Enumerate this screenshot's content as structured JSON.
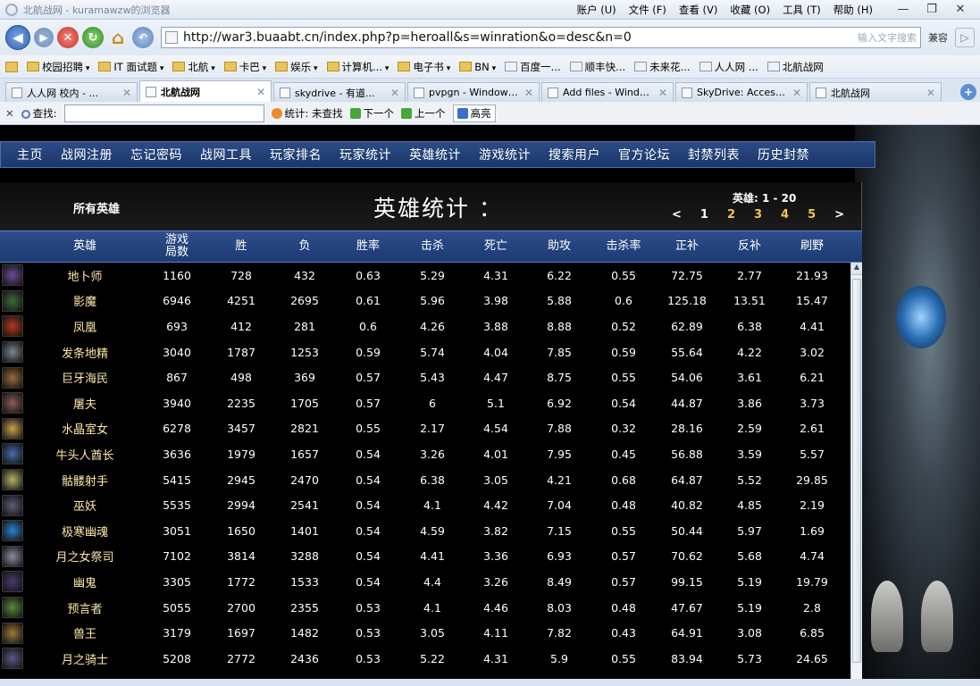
{
  "window": {
    "title": "北航战网 - kuramawzw的浏览器",
    "menus": [
      "账户 (U)",
      "文件 (F)",
      "查看 (V)",
      "收藏 (O)",
      "工具 (T)",
      "帮助 (H)"
    ],
    "controls": [
      "—",
      "❐",
      "✕"
    ]
  },
  "address": {
    "url": "http://war3.buaabt.cn/index.php?p=heroall&s=winration&o=desc&n=0",
    "search_hint": "输入文字搜索",
    "compat_label": "兼容"
  },
  "favorites": [
    {
      "label": "校园招聘",
      "type": "folder"
    },
    {
      "label": "IT 面试题",
      "type": "folder"
    },
    {
      "label": "北航",
      "type": "folder"
    },
    {
      "label": "卡巴",
      "type": "folder"
    },
    {
      "label": "娱乐",
      "type": "folder"
    },
    {
      "label": "计算机...",
      "type": "folder"
    },
    {
      "label": "电子书",
      "type": "folder"
    },
    {
      "label": "BN",
      "type": "folder"
    },
    {
      "label": "百度一...",
      "type": "link"
    },
    {
      "label": "顺丰快...",
      "type": "link"
    },
    {
      "label": "未来花...",
      "type": "link"
    },
    {
      "label": "人人网 ...",
      "type": "link"
    },
    {
      "label": "北航战网",
      "type": "link"
    }
  ],
  "tabs": [
    {
      "label": "人人网 校内 - ...",
      "active": false
    },
    {
      "label": "北航战网",
      "active": true
    },
    {
      "label": "skydrive - 有道...",
      "active": false
    },
    {
      "label": "pvpgn - Windows...",
      "active": false
    },
    {
      "label": "Add files - Windo...",
      "active": false
    },
    {
      "label": "SkyDrive: Access...",
      "active": false
    },
    {
      "label": "北航战网",
      "active": false
    }
  ],
  "findbar": {
    "close": "✕",
    "find_label": "查找:",
    "find_value": "",
    "stats_label": "统计: 未查找",
    "next_label": "下一个",
    "prev_label": "上一个",
    "highlight_label": "高亮"
  },
  "site_nav": [
    "主页",
    "战网注册",
    "忘记密码",
    "战网工具",
    "玩家排名",
    "玩家统计",
    "英雄统计",
    "游戏统计",
    "搜索用户",
    "官方论坛",
    "封禁列表",
    "历史封禁"
  ],
  "header": {
    "all_heroes": "所有英雄",
    "heading": "英雄统计 ：",
    "range": "英雄: 1 - 20",
    "pager": [
      "<",
      "1",
      "2",
      "3",
      "4",
      "5",
      ">"
    ]
  },
  "table": {
    "columns": [
      "英雄",
      "游戏\n局数",
      "胜",
      "负",
      "胜率",
      "击杀",
      "死亡",
      "助攻",
      "击杀率",
      "正补",
      "反补",
      "刷野"
    ],
    "rows": [
      {
        "avatar_color": "#6a4c9c",
        "cells": [
          "地卜师",
          "1160",
          "728",
          "432",
          "0.63",
          "5.29",
          "4.31",
          "6.22",
          "0.55",
          "72.75",
          "2.77",
          "21.93"
        ]
      },
      {
        "avatar_color": "#3f6b3a",
        "cells": [
          "影魔",
          "6946",
          "4251",
          "2695",
          "0.61",
          "5.96",
          "3.98",
          "5.88",
          "0.6",
          "125.18",
          "13.51",
          "15.47"
        ]
      },
      {
        "avatar_color": "#b43a1f",
        "cells": [
          "凤凰",
          "693",
          "412",
          "281",
          "0.6",
          "4.26",
          "3.88",
          "8.88",
          "0.52",
          "62.89",
          "6.38",
          "4.41"
        ]
      },
      {
        "avatar_color": "#7c8592",
        "cells": [
          "发条地精",
          "3040",
          "1787",
          "1253",
          "0.59",
          "5.74",
          "4.04",
          "7.85",
          "0.59",
          "55.64",
          "4.22",
          "3.02"
        ]
      },
      {
        "avatar_color": "#9b6a3b",
        "cells": [
          "巨牙海民",
          "867",
          "498",
          "369",
          "0.57",
          "5.43",
          "4.47",
          "8.75",
          "0.55",
          "54.06",
          "3.61",
          "6.21"
        ]
      },
      {
        "avatar_color": "#8c5a5a",
        "cells": [
          "屠夫",
          "3940",
          "2235",
          "1705",
          "0.57",
          "6",
          "5.1",
          "6.92",
          "0.54",
          "44.87",
          "3.86",
          "3.73"
        ]
      },
      {
        "avatar_color": "#c9a24a",
        "cells": [
          "水晶室女",
          "6278",
          "3457",
          "2821",
          "0.55",
          "2.17",
          "4.54",
          "7.88",
          "0.32",
          "28.16",
          "2.59",
          "2.61"
        ]
      },
      {
        "avatar_color": "#4a6aa8",
        "cells": [
          "牛头人酋长",
          "3636",
          "1979",
          "1657",
          "0.54",
          "3.26",
          "4.01",
          "7.95",
          "0.45",
          "56.88",
          "3.59",
          "5.57"
        ]
      },
      {
        "avatar_color": "#b9b06a",
        "cells": [
          "骷髅射手",
          "5415",
          "2945",
          "2470",
          "0.54",
          "6.38",
          "3.05",
          "4.21",
          "0.68",
          "64.87",
          "5.52",
          "29.85"
        ]
      },
      {
        "avatar_color": "#5a5f78",
        "cells": [
          "巫妖",
          "5535",
          "2994",
          "2541",
          "0.54",
          "4.1",
          "4.42",
          "7.04",
          "0.48",
          "40.82",
          "4.85",
          "2.19"
        ]
      },
      {
        "avatar_color": "#2f7fc9",
        "cells": [
          "极寒幽魂",
          "3051",
          "1650",
          "1401",
          "0.54",
          "4.59",
          "3.82",
          "7.15",
          "0.55",
          "50.44",
          "5.97",
          "1.69"
        ]
      },
      {
        "avatar_color": "#8a8fa0",
        "cells": [
          "月之女祭司",
          "7102",
          "3814",
          "3288",
          "0.54",
          "4.41",
          "3.36",
          "6.93",
          "0.57",
          "70.62",
          "5.68",
          "4.74"
        ]
      },
      {
        "avatar_color": "#4b3b6b",
        "cells": [
          "幽鬼",
          "3305",
          "1772",
          "1533",
          "0.54",
          "4.4",
          "3.26",
          "8.49",
          "0.57",
          "99.15",
          "5.19",
          "19.79"
        ]
      },
      {
        "avatar_color": "#5c8a3c",
        "cells": [
          "预言者",
          "5055",
          "2700",
          "2355",
          "0.53",
          "4.1",
          "4.46",
          "8.03",
          "0.48",
          "47.67",
          "5.19",
          "2.8"
        ]
      },
      {
        "avatar_color": "#9a7a3a",
        "cells": [
          "兽王",
          "3179",
          "1697",
          "1482",
          "0.53",
          "3.05",
          "4.11",
          "7.82",
          "0.43",
          "64.91",
          "3.08",
          "6.85"
        ]
      },
      {
        "avatar_color": "#5a5a88",
        "cells": [
          "月之骑士",
          "5208",
          "2772",
          "2436",
          "0.53",
          "5.22",
          "4.31",
          "5.9",
          "0.55",
          "83.94",
          "5.73",
          "24.65"
        ]
      }
    ]
  }
}
